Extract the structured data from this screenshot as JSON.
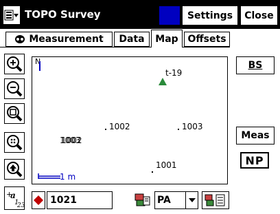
{
  "titlebar": {
    "title": "TOPO Survey",
    "settings_label": "Settings",
    "close_label": "Close",
    "start_icon": "start-menu-icon"
  },
  "tabs": [
    {
      "label": "Measurement",
      "icon": "measurement-icon"
    },
    {
      "label": "Data"
    },
    {
      "label": "Map",
      "active": true
    },
    {
      "label": "Offsets"
    }
  ],
  "toolbar": {
    "zoom_in": "zoom-in-icon",
    "zoom_out": "zoom-out-icon",
    "zoom_window": "zoom-window-icon",
    "zoom_extents": "zoom-extents-icon",
    "pan": "pan-icon"
  },
  "map": {
    "north_label": "N",
    "scale_label": "1 m",
    "points": [
      {
        "name": "t-19",
        "kind": "target"
      },
      {
        "name": "1002",
        "kind": "point"
      },
      {
        "name": "1003",
        "kind": "point"
      },
      {
        "name": "1001",
        "kind": "point"
      },
      {
        "name": "1003",
        "kind": "point"
      },
      {
        "name": "1002",
        "kind": "point"
      }
    ]
  },
  "right_buttons": {
    "bs_label": "BS",
    "meas_label": "Meas",
    "np_label": "NP"
  },
  "bottom": {
    "point_value": "1021",
    "mode_value": "PA",
    "labels_icon": "point-labels-icon"
  },
  "colors": {
    "accent": "#0000c0",
    "marker": "#c00000",
    "target": "#2a8a3a"
  }
}
